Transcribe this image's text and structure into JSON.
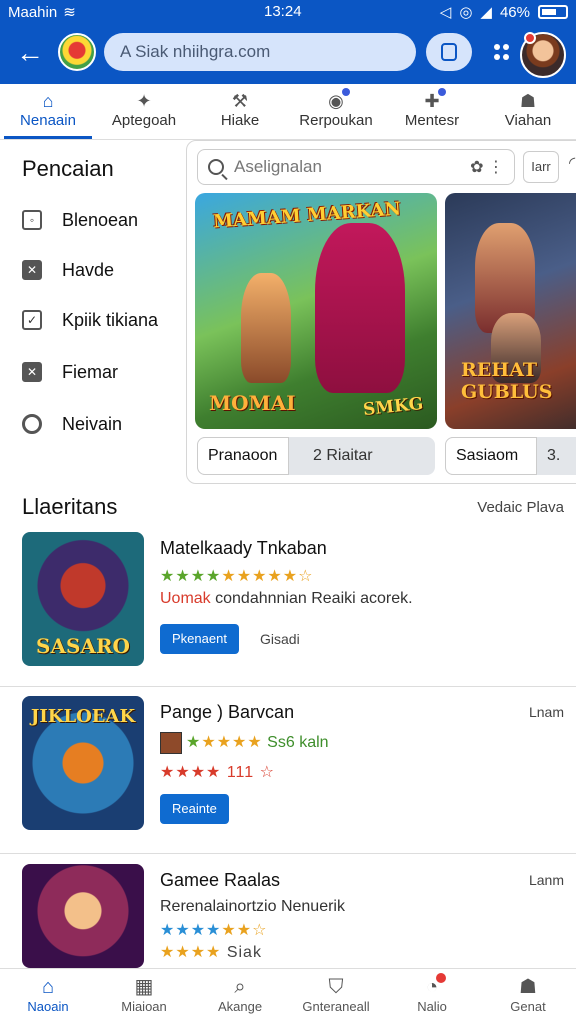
{
  "status_bar": {
    "carrier": "Maahin",
    "time": "13:24",
    "battery": "46%"
  },
  "app_bar": {
    "url": "A Siak nhiihgra.com"
  },
  "top_tabs": [
    {
      "label": "Nenaain",
      "icon": "home-icon",
      "active": true
    },
    {
      "label": "Aptegoah",
      "icon": "controller-icon",
      "active": false
    },
    {
      "label": "Hiake",
      "icon": "hammer-icon",
      "active": false
    },
    {
      "label": "Rerpoukan",
      "icon": "gamepad-icon",
      "active": false
    },
    {
      "label": "Mentesr",
      "icon": "puzzle-icon",
      "active": false
    },
    {
      "label": "Viahan",
      "icon": "person-icon",
      "active": false
    }
  ],
  "filters": {
    "title": "Pencaian",
    "items": [
      {
        "label": "Blenoean",
        "icon": "checkbox-icon"
      },
      {
        "label": "Havde",
        "icon": "checkbox-checked-icon"
      },
      {
        "label": "Kpiik tikiana",
        "icon": "checkbox-checked-icon"
      },
      {
        "label": "Fiemar",
        "icon": "checkbox-checked-icon"
      },
      {
        "label": "Neivain",
        "icon": "search-icon"
      }
    ]
  },
  "featured": {
    "search_placeholder": "Aselignalan",
    "filter_chip": "Iarr",
    "banners": [
      {
        "logo_top": "MAMAM MARKAN",
        "logo_bottom_left": "MOMAI",
        "logo_bottom_right": "SMKG"
      },
      {
        "logo": "REHAT GUBLUS"
      }
    ],
    "actions": [
      {
        "primary": "Pranaoon",
        "secondary": "2  Riaitar"
      },
      {
        "primary": "Sasiaom",
        "secondary": "3."
      }
    ]
  },
  "section": {
    "title": "Llaeritans",
    "link": "Vedaic Plava"
  },
  "list": [
    {
      "title": "Matelkaady Tnkaban",
      "thumb_label": "SASARO",
      "stars": "★★★★★☆",
      "line": {
        "highlight": "Uomak",
        "text": " condahnnian Reaiki acorek."
      },
      "button": "Pkenaent",
      "secondary": "Gisadi"
    },
    {
      "title": "Pange ) Barvcan",
      "meta": "Lnam",
      "thumb_label": "JIKLOEAK",
      "rating_line": "Ss6 kaln",
      "stars2": "★★★★ 111 ☆",
      "button": "Reainte"
    },
    {
      "title": "Gamee Raalas",
      "meta": "Lanm",
      "line_green": "Rerenalainortzio Nenuerik",
      "stars_label": "Siak"
    }
  ],
  "bottom_nav": [
    {
      "label": "Naoain",
      "icon": "home-icon",
      "active": true
    },
    {
      "label": "Miaioan",
      "icon": "grid-icon",
      "active": false
    },
    {
      "label": "Akange",
      "icon": "search-icon",
      "active": false
    },
    {
      "label": "Gnteraneall",
      "icon": "shield-icon",
      "active": false
    },
    {
      "label": "Nalio",
      "icon": "notification-icon",
      "active": false
    },
    {
      "label": "Genat",
      "icon": "person-icon",
      "active": false
    }
  ]
}
